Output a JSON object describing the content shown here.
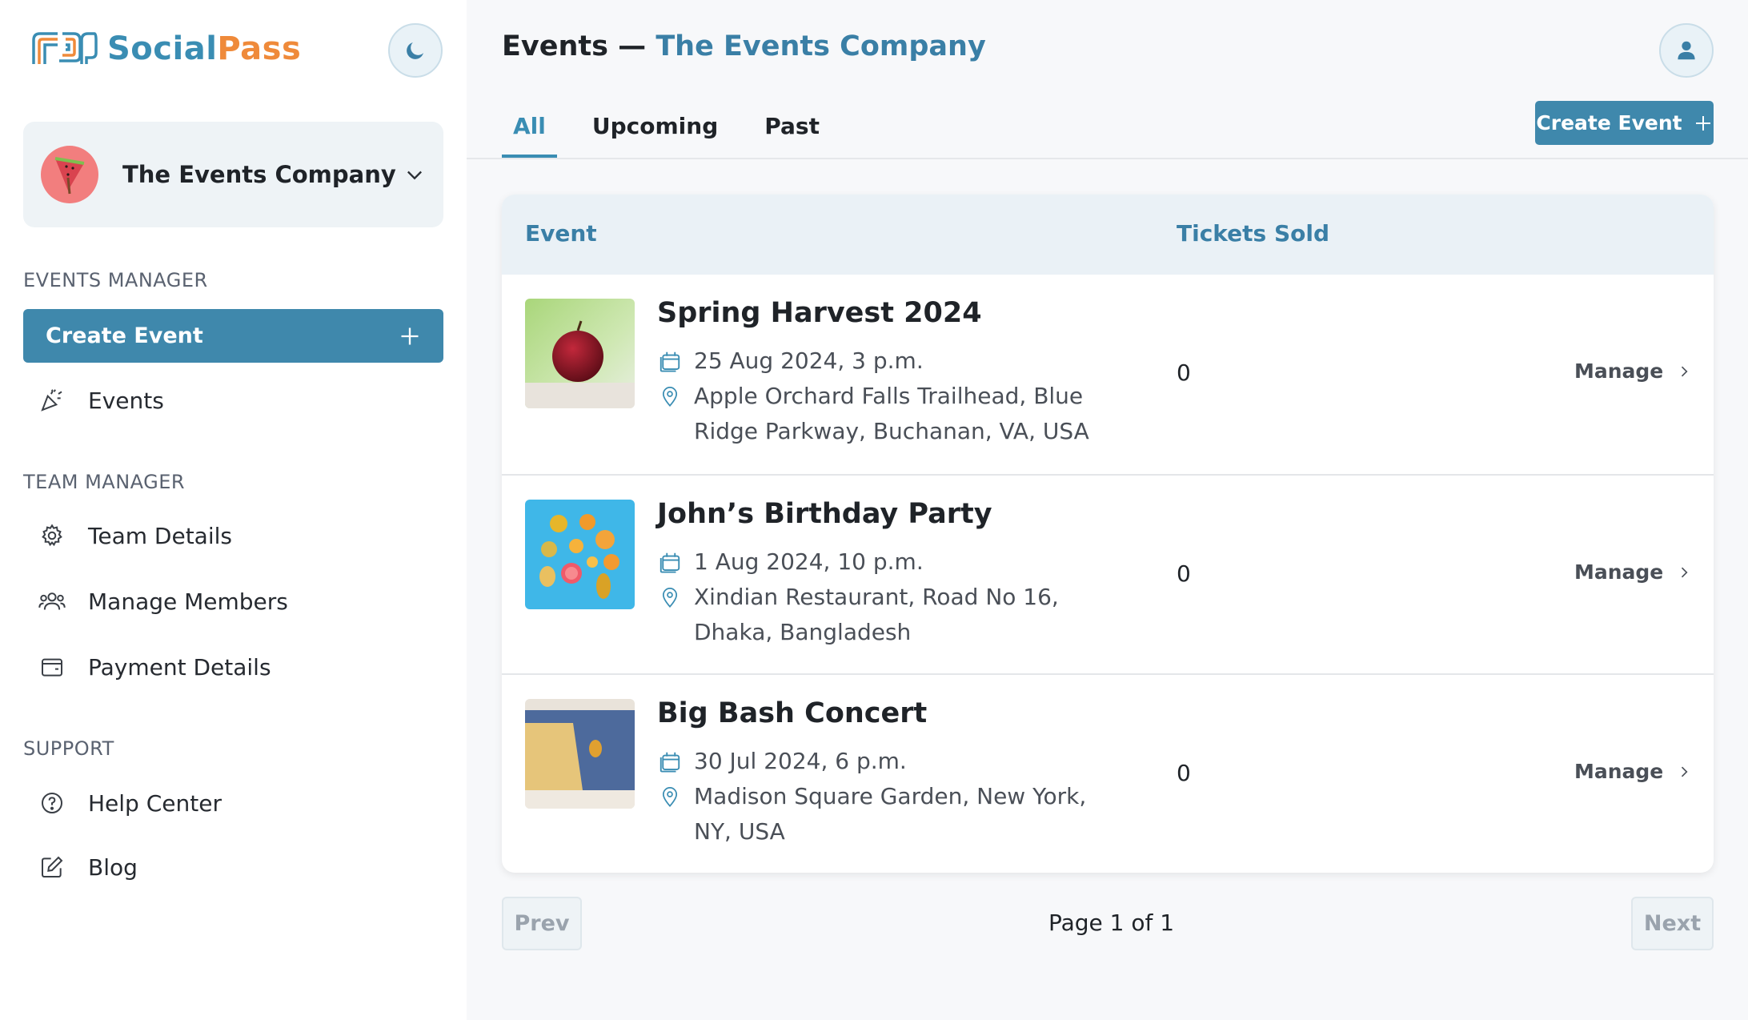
{
  "brand": {
    "social": "Social",
    "pass": "Pass"
  },
  "org": {
    "name": "The Events Company"
  },
  "sidebar": {
    "events_manager_label": "EVENTS MANAGER",
    "create_event_label": "Create Event",
    "events_label": "Events",
    "team_manager_label": "TEAM MANAGER",
    "team_details_label": "Team Details",
    "manage_members_label": "Manage Members",
    "payment_details_label": "Payment Details",
    "support_label": "SUPPORT",
    "help_center_label": "Help Center",
    "blog_label": "Blog"
  },
  "header": {
    "title_prefix": "Events — ",
    "title_company": "The Events Company",
    "create_event_label": "Create Event"
  },
  "tabs": [
    "All",
    "Upcoming",
    "Past"
  ],
  "table": {
    "col_event": "Event",
    "col_tickets": "Tickets Sold",
    "manage_label": "Manage",
    "rows": [
      {
        "title": "Spring Harvest 2024",
        "date": "25 Aug 2024, 3 p.m.",
        "location": "Apple Orchard Falls Trailhead, Blue Ridge Parkway, Buchanan, VA, USA",
        "tickets": "0"
      },
      {
        "title": "John’s Birthday Party",
        "date": "1 Aug 2024, 10 p.m.",
        "location": "Xindian Restaurant, Road No 16, Dhaka, Bangladesh",
        "tickets": "0"
      },
      {
        "title": "Big Bash Concert",
        "date": "30 Jul 2024, 6 p.m.",
        "location": "Madison Square Garden, New York, NY, USA",
        "tickets": "0"
      }
    ]
  },
  "pagination": {
    "prev": "Prev",
    "next": "Next",
    "page_text": "Page 1 of 1"
  },
  "colors": {
    "accent": "#3f88ac",
    "brand_orange": "#ef8a3a",
    "title_blue": "#3a7fa6"
  }
}
